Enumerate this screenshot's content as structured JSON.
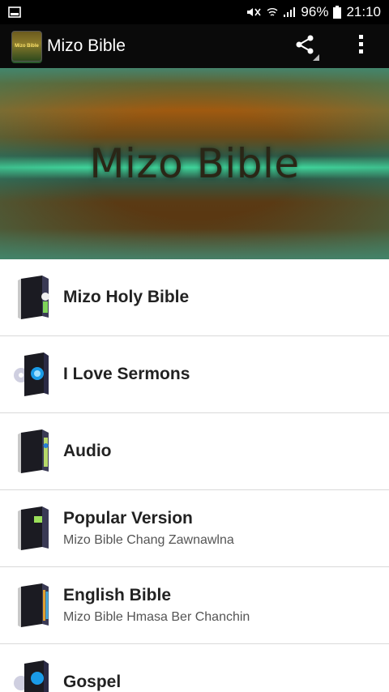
{
  "status_bar": {
    "battery": "96%",
    "time": "21:10"
  },
  "app_bar": {
    "logo_text": "Mizo Bible",
    "title": "Mizo Bible"
  },
  "banner": {
    "title": "Mizo Bible"
  },
  "menu": {
    "items": [
      {
        "title": "Mizo Holy Bible",
        "subtitle": "",
        "icon": "book-skull-icon"
      },
      {
        "title": "I Love Sermons",
        "subtitle": "",
        "icon": "book-cd-icon"
      },
      {
        "title": "Audio",
        "subtitle": "",
        "icon": "book-audio-icon"
      },
      {
        "title": "Popular Version",
        "subtitle": "Mizo Bible Chang Zawnawlna",
        "icon": "book-green-icon"
      },
      {
        "title": "English Bible",
        "subtitle": "Mizo Bible Hmasa Ber Chanchin",
        "icon": "book-shelf-icon"
      },
      {
        "title": "Gospel",
        "subtitle": "",
        "icon": "book-blue-icon"
      }
    ]
  }
}
